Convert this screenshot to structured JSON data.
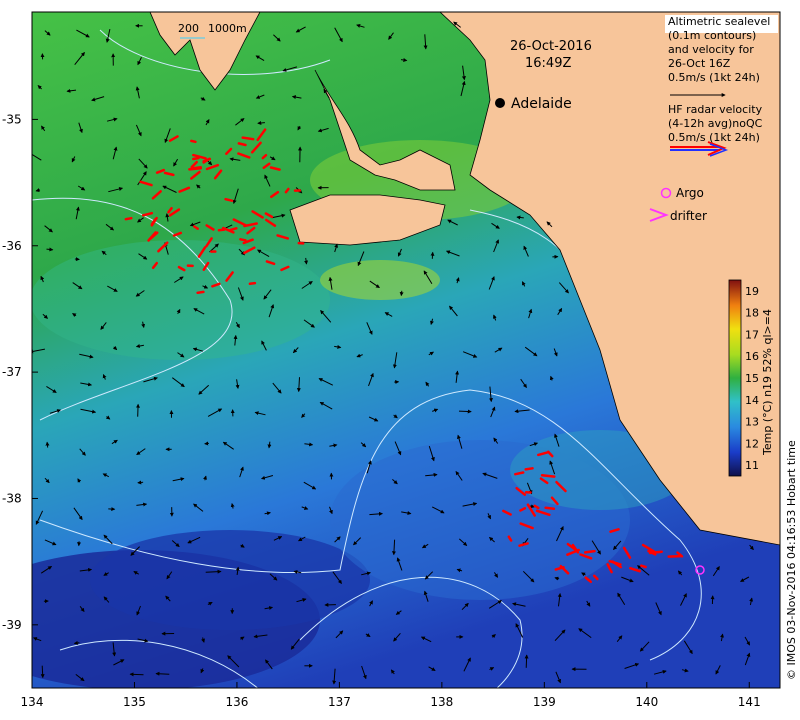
{
  "title": {
    "date": "26-Oct-2016",
    "time": "16:49Z"
  },
  "legend": {
    "altimetry_lines": [
      "Altimetric sealevel",
      "(0.1m contours)",
      "and velocity for",
      "26-Oct 16Z",
      "0.5m/s (1kt 24h)"
    ],
    "radar_lines": [
      "HF radar velocity",
      "(4-12h avg)noQC",
      "0.5m/s (1kt 24h)"
    ],
    "argo_label": "Argo",
    "drifter_label": "drifter"
  },
  "depth_legend": {
    "label_200": "200",
    "label_1000": "1000m"
  },
  "city": {
    "name": "Adelaide"
  },
  "axes": {
    "x_ticks": [
      "134",
      "135",
      "136",
      "137",
      "138",
      "139",
      "140",
      "141"
    ],
    "x_range": [
      134,
      141.3
    ],
    "y_ticks": [
      "-35",
      "-36",
      "-37",
      "-38",
      "-39"
    ],
    "y_range": [
      -39.5,
      -34.15
    ]
  },
  "colorbar": {
    "ticks": [
      "11",
      "12",
      "13",
      "14",
      "15",
      "16",
      "17",
      "18",
      "19"
    ],
    "range": [
      10.5,
      19.5
    ],
    "label": "Temp (°C) n19 52% ql>=4"
  },
  "credit": "© IMOS 03-Nov-2016 04:16:53 Hobart time",
  "colors": {
    "land": "#f7c59a",
    "radar_arrow": "#ff0000",
    "argo": "#ff33ff",
    "drifter": "#ff33ff"
  }
}
